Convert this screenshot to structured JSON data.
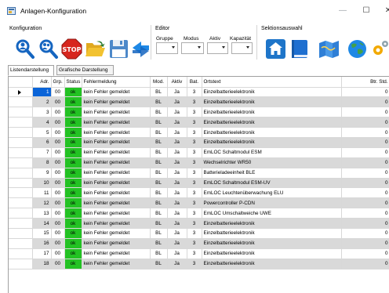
{
  "window": {
    "title": "Anlagen-Konfiguration",
    "minimize": "—",
    "maximize": "☐",
    "close": "✕"
  },
  "ribbon": {
    "groups": {
      "konfiguration": "Konfiguration",
      "editor": "Editor",
      "sektionsauswahl": "Sektionsauswahl"
    },
    "editor_labels": {
      "gruppe": "Gruppe",
      "modus": "Modus",
      "aktiv": "Aktiv",
      "kapazitaet": "Kapazität"
    },
    "konfiguration_buttons": [
      "user-search-icon",
      "user-search-alt-icon",
      "stop-icon",
      "open-folder-icon",
      "save-icon",
      "refresh-icon"
    ],
    "sektion_buttons": [
      "home-icon",
      "book-icon",
      "map-icon",
      "globe-icon",
      "settings-icon"
    ],
    "colors": {
      "stop_red": "#d7261e",
      "home_blue": "#1e75c9",
      "folder_yellow": "#f2c230",
      "save_blue": "#4c88c9"
    }
  },
  "tabs": [
    {
      "label": "Listendarstellung",
      "active": true
    },
    {
      "label": "Grafische Darstellung",
      "active": false
    }
  ],
  "table": {
    "columns": [
      "Adr.",
      "Grp.",
      "Status",
      "Fehlermeldung",
      "Mod.",
      "Aktiv",
      "Bat.",
      "Ortstext",
      "Btr. Std."
    ],
    "rows": [
      {
        "adr": "1",
        "grp": "00",
        "status": "ok",
        "msg": "kein Fehler gemeldet",
        "mod": "BL",
        "aktiv": "Ja",
        "bat": "3",
        "ort": "Einzelbatterieelektronik",
        "btr": "0"
      },
      {
        "adr": "2",
        "grp": "00",
        "status": "ok",
        "msg": "kein Fehler gemeldet",
        "mod": "BL",
        "aktiv": "Ja",
        "bat": "3",
        "ort": "Einzelbatterieelektronik",
        "btr": "0"
      },
      {
        "adr": "3",
        "grp": "00",
        "status": "ok",
        "msg": "kein Fehler gemeldet",
        "mod": "BL",
        "aktiv": "Ja",
        "bat": "3",
        "ort": "Einzelbatterieelektronik",
        "btr": "0"
      },
      {
        "adr": "4",
        "grp": "00",
        "status": "ok",
        "msg": "kein Fehler gemeldet",
        "mod": "BL",
        "aktiv": "Ja",
        "bat": "3",
        "ort": "Einzelbatterieelektronik",
        "btr": "0"
      },
      {
        "adr": "5",
        "grp": "00",
        "status": "ok",
        "msg": "kein Fehler gemeldet",
        "mod": "BL",
        "aktiv": "Ja",
        "bat": "3",
        "ort": "Einzelbatterieelektronik",
        "btr": "0"
      },
      {
        "adr": "6",
        "grp": "00",
        "status": "ok",
        "msg": "kein Fehler gemeldet",
        "mod": "BL",
        "aktiv": "Ja",
        "bat": "3",
        "ort": "Einzelbatterieelektronik",
        "btr": "0"
      },
      {
        "adr": "7",
        "grp": "00",
        "status": "ok",
        "msg": "kein Fehler gemeldet",
        "mod": "BL",
        "aktiv": "Ja",
        "bat": "3",
        "ort": "EmLOC Schaltmodul ESM",
        "btr": "0"
      },
      {
        "adr": "8",
        "grp": "00",
        "status": "ok",
        "msg": "kein Fehler gemeldet",
        "mod": "BL",
        "aktiv": "Ja",
        "bat": "3",
        "ort": "Wechselrichter WR50",
        "btr": "0"
      },
      {
        "adr": "9",
        "grp": "00",
        "status": "ok",
        "msg": "kein Fehler gemeldet",
        "mod": "BL",
        "aktiv": "Ja",
        "bat": "3",
        "ort": "Batterieladeeinheit BLE",
        "btr": "0"
      },
      {
        "adr": "10",
        "grp": "00",
        "status": "ok",
        "msg": "kein Fehler gemeldet",
        "mod": "BL",
        "aktiv": "Ja",
        "bat": "3",
        "ort": "EmLOC Schaltmodul ESM-UV",
        "btr": "0"
      },
      {
        "adr": "11",
        "grp": "00",
        "status": "ok",
        "msg": "kein Fehler gemeldet",
        "mod": "BL",
        "aktiv": "Ja",
        "bat": "3",
        "ort": "EmLOC Leuchtenüberwachung ELU",
        "btr": "0"
      },
      {
        "adr": "12",
        "grp": "00",
        "status": "ok",
        "msg": "kein Fehler gemeldet",
        "mod": "BL",
        "aktiv": "Ja",
        "bat": "3",
        "ort": "Powercontroller P-CDN",
        "btr": "0"
      },
      {
        "adr": "13",
        "grp": "00",
        "status": "ok",
        "msg": "kein Fehler gemeldet",
        "mod": "BL",
        "aktiv": "Ja",
        "bat": "3",
        "ort": "EmLOC Umschaltweiche UWE",
        "btr": "0"
      },
      {
        "adr": "14",
        "grp": "00",
        "status": "ok",
        "msg": "kein Fehler gemeldet",
        "mod": "BL",
        "aktiv": "Ja",
        "bat": "3",
        "ort": "Einzelbatterieelektronik",
        "btr": "0"
      },
      {
        "adr": "15",
        "grp": "00",
        "status": "ok",
        "msg": "kein Fehler gemeldet",
        "mod": "BL",
        "aktiv": "Ja",
        "bat": "3",
        "ort": "Einzelbatterieelektronik",
        "btr": "0"
      },
      {
        "adr": "16",
        "grp": "00",
        "status": "ok",
        "msg": "kein Fehler gemeldet",
        "mod": "BL",
        "aktiv": "Ja",
        "bat": "3",
        "ort": "Einzelbatterieelektronik",
        "btr": "0"
      },
      {
        "adr": "17",
        "grp": "00",
        "status": "ok",
        "msg": "kein Fehler gemeldet",
        "mod": "BL",
        "aktiv": "Ja",
        "bat": "3",
        "ort": "Einzelbatterieelektronik",
        "btr": "0"
      },
      {
        "adr": "18",
        "grp": "00",
        "status": "ok",
        "msg": "kein Fehler gemeldet",
        "mod": "BL",
        "aktiv": "Ja",
        "bat": "3",
        "ort": "Einzelbatterieelektronik",
        "btr": "0"
      }
    ],
    "row_colors": {
      "odd": "#ffffff",
      "even": "#d9d9d9",
      "status_ok": "#23c223",
      "selected": "#0a64d8"
    }
  }
}
